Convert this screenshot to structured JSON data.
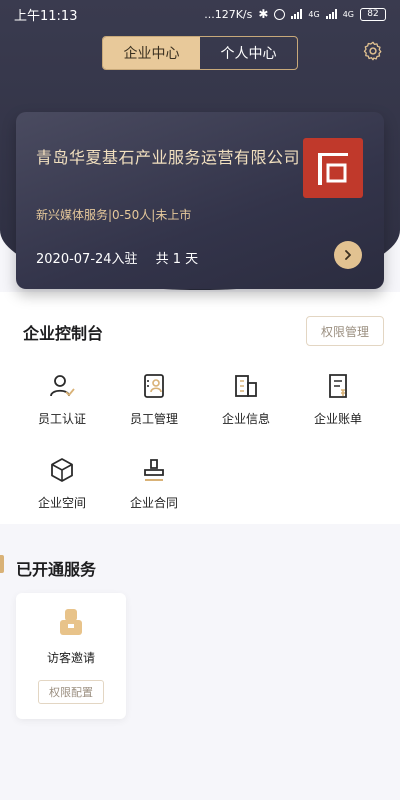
{
  "status_bar": {
    "time": "上午11:13",
    "net_speed": "...127K/s",
    "network_1": "4G",
    "network_2": "4G",
    "battery": "82"
  },
  "header": {
    "tabs": [
      {
        "label": "企业中心",
        "active": true
      },
      {
        "label": "个人中心",
        "active": false
      }
    ],
    "settings_icon": "gear-icon"
  },
  "company": {
    "name": "青岛华夏基石产业服务运营有限公司",
    "meta": "新兴媒体服务|0-50人|未上市",
    "join_date": "2020-07-24入驻",
    "duration": "共 1 天",
    "logo_color": "#c0392b"
  },
  "console": {
    "title": "企业控制台",
    "permission_button": "权限管理",
    "items": [
      {
        "label": "员工认证",
        "icon": "user-verify-icon"
      },
      {
        "label": "员工管理",
        "icon": "employee-manage-icon"
      },
      {
        "label": "企业信息",
        "icon": "building-icon"
      },
      {
        "label": "企业账单",
        "icon": "bill-icon"
      },
      {
        "label": "企业空间",
        "icon": "cube-icon"
      },
      {
        "label": "企业合同",
        "icon": "stamp-icon"
      }
    ]
  },
  "services": {
    "title": "已开通服务",
    "items": [
      {
        "label": "访客邀请",
        "icon": "visitor-icon",
        "config_button": "权限配置"
      }
    ]
  },
  "colors": {
    "header_bg": "#34354a",
    "accent_gold": "#e2c291",
    "text_gold": "#f2e0bf"
  }
}
